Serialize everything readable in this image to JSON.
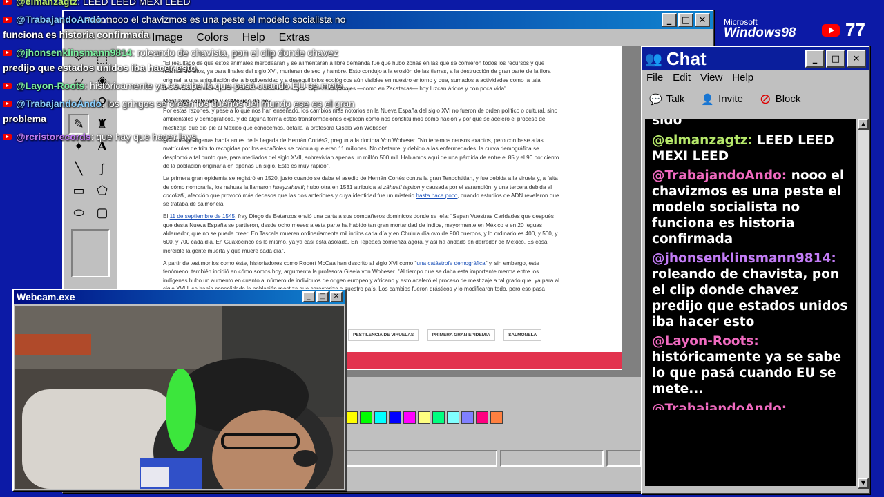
{
  "paint": {
    "title_fragment": "Paint",
    "menu": [
      "Image",
      "Colors",
      "Help",
      "Extras"
    ],
    "palette": [
      "#ffff00",
      "#00ff00",
      "#00ffff",
      "#0000ff",
      "#ff00ff",
      "#ffff80",
      "#00ff80",
      "#80ffff",
      "#8080ff",
      "#ff0080",
      "#ff8040"
    ]
  },
  "article": {
    "p1": "\"El resultado de que estos animales merodearan y se alimentaran a libre demanda fue que hubo zonas en las que se comieron todos los recursos y que muchos de ellos, ya para finales del siglo XVI, murieran de sed y hambre. Esto condujo a la erosión de las tierras, a la destrucción de gran parte de la flora original, a una aniquilación de la biodiversidad y a desequilibrios ecológicos aún visibles en nuestro entorno y que, sumados a actividades como la tala desmedida y la minería, convirtieron ecosistemas de gran riqueza en parajes —como en Zacatecas— hoy luzcan áridos y con poca vida\".",
    "h": "Mestizaje acelerado y el México de hoy",
    "p2": "Por estas razones, y pese a lo que nos han enseñado, los cambios más notorios en la Nueva España del siglo XVI no fueron de orden político o cultural, sino ambientales y demográficos, y de alguna forma estas transformaciones explican cómo nos constituimos como nación y por qué se aceleró el proceso de mestizaje que dio pie al México que conocemos, detalla la profesora Gisela von Wobeser.",
    "p3": "¿Cuántos indígenas había antes de la llegada de Hernán Cortés?, pregunta la doctora Von Wobeser. \"No tenemos censos exactos, pero con base a las matrículas de tributo recogidas por los españoles se calcula que eran 11 millones. No obstante, y debido a las enfermedades, la curva demográfica se desplomó a tal punto que, para mediados del siglo XVII, sobrevivían apenas un millón 500 mil. Hablamos aquí de una pérdida de entre el 85 y el 90 por ciento de la población originaria en apenas un siglo. Esto es muy rápido\".",
    "p4a": "La primera gran epidemia se registró en 1520, justo cuando se daba el asedio de Hernán Cortés contra la gran Tenochtitlan, y fue debida a la viruela y, a falta de cómo nombrarla, los nahuas la llamaron ",
    "p4b": "hueyzahuatl",
    "p4c": "; hubo otra en 1531 atribuida al ",
    "p4d": "záhuatl tepiton",
    "p4e": " y causada por el sarampión, y una tercera debida al ",
    "p4f": "cocoliztli",
    "p4g": ", afección que provocó más decesos que las dos anteriores y cuya identidad fue un misterio ",
    "p4link": "hasta hace poco",
    "p4h": ", cuando estudios de ADN revelaron que se trataba de salmonela",
    "p5a": "El ",
    "p5link": "11 de septiembre de 1545",
    "p5b": ", fray Diego de Betanzos envió una carta a sus compañeros dominicos donde se leía: \"Sepan Vuestras Caridades que después que desta Nueva España se partieron, desde ocho meses a esta parte ha habido tan gran mortandad de indios, mayormente en México e en 20 leguas alderredor, que no se puede creer. En Tascala mueren ordinariamente mil indios cada día y en Chulula día ovo de 900 cuerpos, y lo ordinario es 400, y 500, y 600, y 700 cada día. En Guaxocinco es lo mismo, ya ya casi está asolada. En Tepeaca comienza agora, y así ha andado en derredor de México. Es cosa increíble la gente muerta y que muere cada día\".",
    "p6a": "A partir de testimonios como éste, historiadores como Robert McCaa han descrito al siglo XVI como \"",
    "p6link": "una catástrofe demográfica",
    "p6b": "\" y, sin embargo, este fenómeno, también incidió en cómo somos hoy, argumenta la profesora Gisela von Wobeser. \"Al tiempo que se daba esta importante merma entre los indígenas hubo un aumento en cuanto al número de individuos de origen europeo y africano y esto aceleró el proceso de mestizaje a tal grado que, ya para al siglo XVIII, se había consolidado la población mestiza que caracteriza a nuestro país. Los cambios fueron drásticos y lo modificaron todo, pero eso pasa",
    "tags": [
      "PESTILENCIA DE VIRUELAS",
      "PRIMERA GRAN EPIDEMIA",
      "SALMONELA"
    ]
  },
  "brand": {
    "ms": "Microsoft",
    "win": "Windows98",
    "viewers": "77"
  },
  "chat": {
    "title": "Chat",
    "menu": [
      "File",
      "Edit",
      "View",
      "Help"
    ],
    "toolbar": [
      "Talk",
      "Invite",
      "Block"
    ],
    "partial_top": "sido",
    "messages": [
      {
        "user": "@elmanzagtz:",
        "text": "LEED LEED MEXI LEED",
        "color": "#b6e86a"
      },
      {
        "user": "@TrabajandoAndo:",
        "text": "nooo el chavizmos es una peste el modelo socialista no funciona es historia confirmada",
        "color": "#f06ac0"
      },
      {
        "user": "@jhonsenklinsmann9814:",
        "text": "roleando de chavista, pon el clip donde chavez predijo que estados unidos iba hacer esto",
        "color": "#c27cf5"
      },
      {
        "user": "@Layon-Roots:",
        "text": "históricamente ya se sabe lo que pasá cuando EU se mete...",
        "color": "#f06ac0"
      }
    ],
    "partial_bottom": "@TrabajandoAndo:"
  },
  "overlay": [
    {
      "user": "@elmanzagtz",
      "text": ": LEED LEED MEXI LEED",
      "color": "#b6e86a"
    },
    {
      "user": "@TrabajandoAndo",
      "text": ": nooo el chavizmos es una peste el modelo socialista no",
      "color": "#8ad0ff"
    },
    {
      "user": "",
      "text": "funciona es historia confirmada",
      "color": "#fff"
    },
    {
      "user": "@jhonsenklinsmann9814",
      "text": ": roleando de chavista, pon el clip donde chavez",
      "color": "#7cf0a0"
    },
    {
      "user": "",
      "text": "predijo que estados unidos iba hacer esto",
      "color": "#fff"
    },
    {
      "user": "@Layon-Roots",
      "text": ": históricamente ya se sabe lo que pasá cuando EU se mete...",
      "color": "#7cf0a0"
    },
    {
      "user": "@TrabajandoAndo",
      "text": ": los gringos se creen los dueños del mundo ese es el gran",
      "color": "#8ad0ff"
    },
    {
      "user": "",
      "text": "problema",
      "color": "#fff"
    },
    {
      "user": "@rcristorecords",
      "text": ": que hay que hacer lays",
      "color": "#c27cf5"
    }
  ],
  "webcam": {
    "title": "Webcam.exe"
  }
}
